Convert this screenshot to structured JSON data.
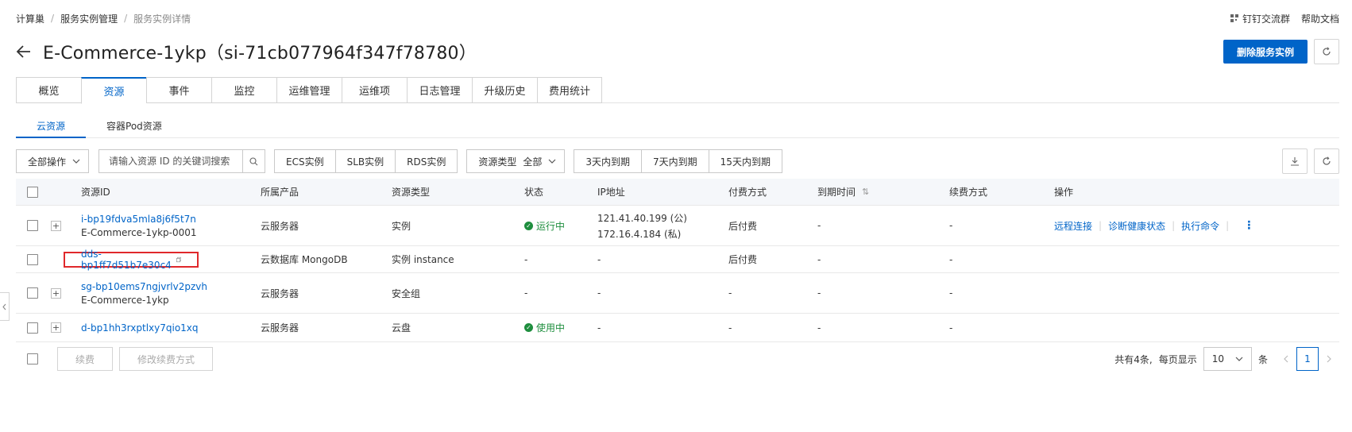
{
  "breadcrumb": [
    "计算巢",
    "服务实例管理",
    "服务实例详情"
  ],
  "top_links": {
    "dingtalk": "钉钉交流群",
    "help": "帮助文档"
  },
  "page": {
    "title": "E-Commerce-1ykp（si-71cb077964f347f78780）",
    "delete_button": "删除服务实例"
  },
  "main_tabs": [
    "概览",
    "资源",
    "事件",
    "监控",
    "运维管理",
    "运维项",
    "日志管理",
    "升级历史",
    "费用统计"
  ],
  "main_tab_active": "资源",
  "sub_tabs": [
    "云资源",
    "容器Pod资源"
  ],
  "toolbar": {
    "bulk_ops": "全部操作",
    "search_placeholder": "请输入资源 ID 的关键词搜索",
    "filter_buttons": [
      "ECS实例",
      "SLB实例",
      "RDS实例"
    ],
    "resource_type_label": "资源类型",
    "resource_type_value": "全部",
    "expire_buttons": [
      "3天内到期",
      "7天内到期",
      "15天内到期"
    ]
  },
  "table": {
    "headers": [
      "资源ID",
      "所属产品",
      "资源类型",
      "状态",
      "IP地址",
      "付费方式",
      "到期时间",
      "续费方式",
      "操作"
    ],
    "rows": [
      {
        "id": "i-bp19fdva5mla8j6f5t7n",
        "name": "E-Commerce-1ykp-0001",
        "product": "云服务器",
        "type": "实例",
        "status": "运行中",
        "ip1": "121.41.40.199 (公)",
        "ip2": "172.16.4.184 (私)",
        "pay": "后付费",
        "expire": "-",
        "renew": "-",
        "ops": [
          "远程连接",
          "诊断健康状态",
          "执行命令"
        ]
      },
      {
        "id": "dds-bp1ff7d51b7e30c4",
        "name": "",
        "product": "云数据库 MongoDB",
        "type": "实例 instance",
        "status": "-",
        "ip1": "-",
        "ip2": "",
        "pay": "后付费",
        "expire": "-",
        "renew": "-",
        "ops": []
      },
      {
        "id": "sg-bp10ems7ngjvrlv2pzvh",
        "name": "E-Commerce-1ykp",
        "product": "云服务器",
        "type": "安全组",
        "status": "-",
        "ip1": "-",
        "ip2": "",
        "pay": "-",
        "expire": "-",
        "renew": "-",
        "ops": []
      },
      {
        "id": "d-bp1hh3rxptlxy7qio1xq",
        "name": "",
        "product": "云服务器",
        "type": "云盘",
        "status": "使用中",
        "ip1": "-",
        "ip2": "",
        "pay": "-",
        "expire": "-",
        "renew": "-",
        "ops": []
      }
    ]
  },
  "footer": {
    "renew_button": "续费",
    "modify_renew_button": "修改续费方式",
    "total_text": "共有4条,",
    "per_page_label": "每页显示",
    "per_page_value": "10",
    "unit": "条",
    "current_page": "1"
  },
  "colors": {
    "primary": "#0064c8",
    "success": "#1e8e3e",
    "highlight": "#e0282b"
  }
}
